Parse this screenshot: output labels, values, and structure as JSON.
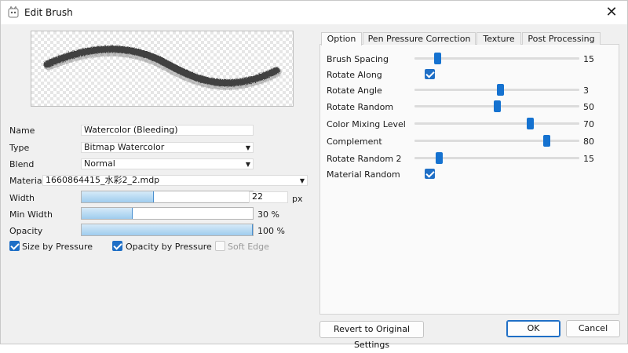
{
  "window": {
    "title": "Edit Brush"
  },
  "icons": {
    "app": "brush-app-icon",
    "close": "close-icon",
    "check": "checkmark-icon",
    "dropdown": "chevron-down-icon"
  },
  "colors": {
    "accent": "#1f6fc6",
    "slider_thumb": "#1572d0",
    "bar_fill": "#9fccee"
  },
  "left": {
    "name": {
      "label": "Name",
      "value": "Watercolor (Bleeding)"
    },
    "type": {
      "label": "Type",
      "value": "Bitmap Watercolor"
    },
    "blend": {
      "label": "Blend",
      "value": "Normal"
    },
    "material": {
      "label": "Material",
      "value": "1660864415_水彩2_2.mdp"
    },
    "width": {
      "label": "Width",
      "value": "22",
      "unit": "px",
      "fill_percent": 42
    },
    "min_width": {
      "label": "Min Width",
      "value": "30 %",
      "fill_percent": 30
    },
    "opacity": {
      "label": "Opacity",
      "value": "100 %",
      "fill_percent": 100
    },
    "checks": [
      {
        "label": "Size by Pressure",
        "checked": true,
        "enabled": true
      },
      {
        "label": "Opacity by Pressure",
        "checked": true,
        "enabled": true
      },
      {
        "label": "Soft Edge",
        "checked": false,
        "enabled": false
      }
    ]
  },
  "tabs": [
    {
      "label": "Option",
      "active": true
    },
    {
      "label": "Pen Pressure Correction",
      "active": false
    },
    {
      "label": "Texture",
      "active": false
    },
    {
      "label": "Post Processing",
      "active": false
    }
  ],
  "options": {
    "brush_spacing": {
      "label": "Brush Spacing",
      "value": "15",
      "level": 0.14
    },
    "rotate_along": {
      "label": "Rotate Along",
      "checked": true
    },
    "rotate_angle": {
      "label": "Rotate Angle",
      "value": "3",
      "level": 0.52
    },
    "rotate_random": {
      "label": "Rotate Random",
      "value": "50",
      "level": 0.5
    },
    "color_mixing": {
      "label": "Color Mixing Level",
      "value": "70",
      "level": 0.7
    },
    "complement": {
      "label": "Complement",
      "value": "80",
      "level": 0.8
    },
    "rotate_random2": {
      "label": "Rotate Random 2",
      "value": "15",
      "level": 0.15
    },
    "material_random": {
      "label": "Material Random",
      "checked": true
    }
  },
  "buttons": {
    "revert": "Revert to Original Settings",
    "ok": "OK",
    "cancel": "Cancel"
  }
}
